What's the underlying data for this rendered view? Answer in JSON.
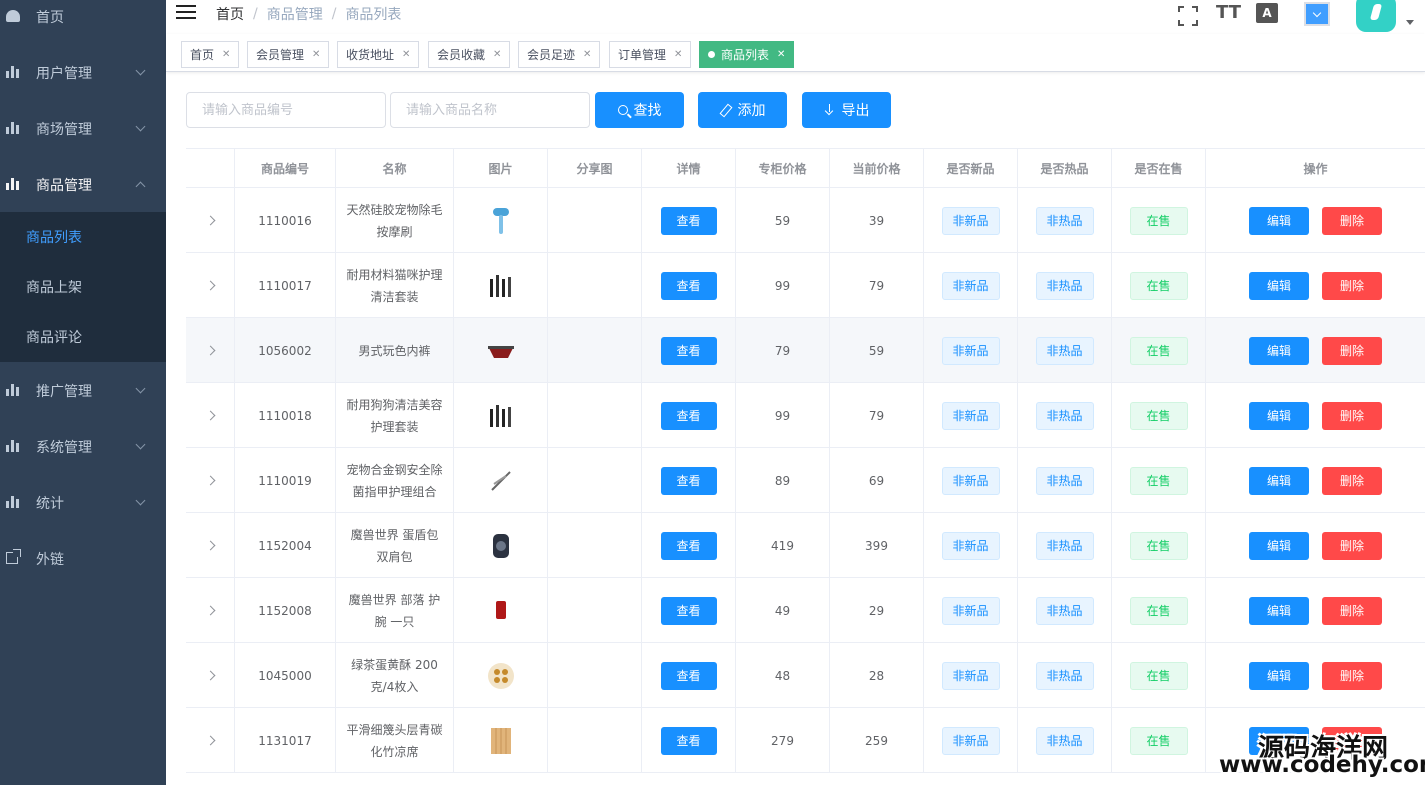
{
  "sidebar": {
    "items": [
      {
        "label": "首页",
        "icon": "dashboard-icon"
      },
      {
        "label": "用户管理",
        "icon": "chart-icon"
      },
      {
        "label": "商场管理",
        "icon": "chart-icon"
      },
      {
        "label": "商品管理",
        "icon": "chart-icon"
      },
      {
        "label": "推广管理",
        "icon": "chart-icon"
      },
      {
        "label": "系统管理",
        "icon": "chart-icon"
      },
      {
        "label": "统计",
        "icon": "chart-icon"
      },
      {
        "label": "外链",
        "icon": "external-link-icon"
      }
    ],
    "submenu": [
      {
        "label": "商品列表",
        "active": true
      },
      {
        "label": "商品上架",
        "active": false
      },
      {
        "label": "商品评论",
        "active": false
      }
    ]
  },
  "header": {
    "breadcrumb": [
      "首页",
      "商品管理",
      "商品列表"
    ],
    "lang_icon_text": "A"
  },
  "tags": [
    {
      "label": "首页"
    },
    {
      "label": "会员管理"
    },
    {
      "label": "收货地址"
    },
    {
      "label": "会员收藏"
    },
    {
      "label": "会员足迹"
    },
    {
      "label": "订单管理"
    },
    {
      "label": "商品列表",
      "active": true
    }
  ],
  "filter": {
    "goods_sn_placeholder": "请输入商品编号",
    "name_placeholder": "请输入商品名称",
    "search_label": "查找",
    "add_label": "添加",
    "export_label": "导出"
  },
  "table": {
    "columns": [
      "",
      "商品编号",
      "名称",
      "图片",
      "分享图",
      "详情",
      "专柜价格",
      "当前价格",
      "是否新品",
      "是否热品",
      "是否在售",
      "操作"
    ],
    "detail_label": "查看",
    "edit_label": "编辑",
    "delete_label": "删除",
    "rows": [
      {
        "sn": "1110016",
        "name": "天然硅胶宠物除毛按摩刷",
        "counter_price": "59",
        "retail_price": "39",
        "is_new": "非新品",
        "is_hot": "非热品",
        "on_sale": "在售",
        "pic": "brush-icon"
      },
      {
        "sn": "1110017",
        "name": "耐用材料猫咪护理清洁套装",
        "counter_price": "99",
        "retail_price": "79",
        "is_new": "非新品",
        "is_hot": "非热品",
        "on_sale": "在售",
        "pic": "tools-icon"
      },
      {
        "sn": "1056002",
        "name": "男式玩色内裤",
        "counter_price": "79",
        "retail_price": "59",
        "is_new": "非新品",
        "is_hot": "非热品",
        "on_sale": "在售",
        "pic": "underwear-icon"
      },
      {
        "sn": "1110018",
        "name": "耐用狗狗清洁美容护理套装",
        "counter_price": "99",
        "retail_price": "79",
        "is_new": "非新品",
        "is_hot": "非热品",
        "on_sale": "在售",
        "pic": "tools-icon"
      },
      {
        "sn": "1110019",
        "name": "宠物合金钢安全除菌指甲护理组合",
        "counter_price": "89",
        "retail_price": "69",
        "is_new": "非新品",
        "is_hot": "非热品",
        "on_sale": "在售",
        "pic": "clipper-icon"
      },
      {
        "sn": "1152004",
        "name": "魔兽世界 蛋盾包 双肩包",
        "counter_price": "419",
        "retail_price": "399",
        "is_new": "非新品",
        "is_hot": "非热品",
        "on_sale": "在售",
        "pic": "backpack-icon"
      },
      {
        "sn": "1152008",
        "name": "魔兽世界 部落 护腕 一只",
        "counter_price": "49",
        "retail_price": "29",
        "is_new": "非新品",
        "is_hot": "非热品",
        "on_sale": "在售",
        "pic": "wristband-icon"
      },
      {
        "sn": "1045000",
        "name": "绿茶蛋黄酥 200克/4枚入",
        "counter_price": "48",
        "retail_price": "28",
        "is_new": "非新品",
        "is_hot": "非热品",
        "on_sale": "在售",
        "pic": "pastry-icon"
      },
      {
        "sn": "1131017",
        "name": "平滑细篾头层青碳化竹凉席",
        "counter_price": "279",
        "retail_price": "259",
        "is_new": "非新品",
        "is_hot": "非热品",
        "on_sale": "在售",
        "pic": "mat-icon"
      }
    ]
  },
  "watermark": {
    "line1": "源码海洋网",
    "line2": "www.codehy.com"
  },
  "colors": {
    "sidebar_bg": "#304156",
    "submenu_bg": "#1f2d3d",
    "active_menu": "#409eff",
    "primary": "#1890ff",
    "danger": "#ff4949",
    "success": "#13ce66",
    "active_tag": "#42b983"
  }
}
